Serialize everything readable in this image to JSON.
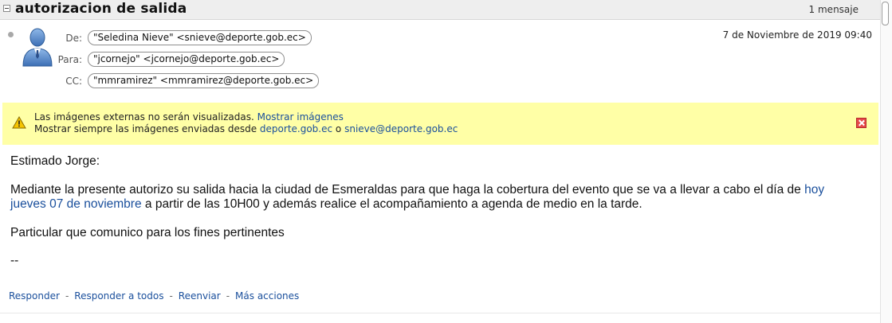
{
  "thread": {
    "subject": "autorizacion de salida",
    "message_count": "1 mensaje"
  },
  "message": {
    "from_label": "De:",
    "from": "\"Seledina Nieve\" <snieve@deporte.gob.ec>",
    "to_label": "Para:",
    "to": "\"jcornejo\" <jcornejo@deporte.gob.ec>",
    "cc_label": "CC:",
    "cc": "\"mmramirez\" <mmramirez@deporte.gob.ec>",
    "date": "7 de Noviembre de 2019 09:40"
  },
  "warning": {
    "line1_text": "Las imágenes externas no serán visualizadas.",
    "line1_link": "Mostrar imágenes",
    "line2_text": "Mostrar siempre las imágenes enviadas desde",
    "line2_domain": "deporte.gob.ec",
    "line2_or": "o",
    "line2_sender": "snieve@deporte.gob.ec"
  },
  "body": {
    "greeting": "Estimado Jorge:",
    "p1_a": "Mediante la presente autorizo su salida hacia la ciudad de Esmeraldas para que haga la cobertura del evento que se va a llevar a cabo el día de",
    "p1_link1": "hoy",
    "p2_link2": "jueves 07 de noviembre",
    "p2_b": "a partir de las 10H00 y además realice el acompañamiento a agenda de medio en la tarde.",
    "p3": "Particular que comunico para los fines pertinentes",
    "signature": "--"
  },
  "actions": {
    "reply": "Responder",
    "reply_all": "Responder a todos",
    "forward": "Reenviar",
    "more": "Más acciones",
    "separator": "-"
  },
  "colors": {
    "link": "#1a4f9c",
    "warning_bg": "#ffffa6",
    "close_red": "#e64a4a"
  }
}
